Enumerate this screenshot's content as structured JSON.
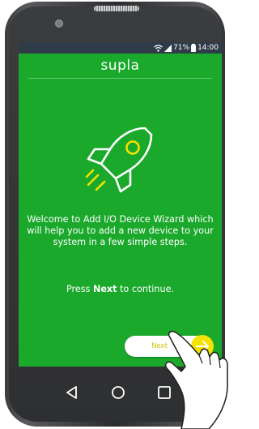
{
  "status_bar": {
    "battery": "71%",
    "time": "14:00",
    "icons": [
      "wifi-icon",
      "signal-icon",
      "battery-icon"
    ]
  },
  "app": {
    "title": "supla"
  },
  "wizard": {
    "welcome_text": "Welcome to Add I/O Device Wizard which will help you to add a new device to your system in a few simple steps.",
    "continue_prefix": "Press",
    "continue_bold": "Next",
    "continue_suffix": "to continue.",
    "next_button_label": "Next",
    "hero_icon": "rocket-icon"
  },
  "navigation": {
    "items": [
      "back-icon",
      "home-icon",
      "recents-icon"
    ]
  },
  "colors": {
    "background": "#1aa92b",
    "status_bar": "#2f3b49",
    "accent": "#f4e200",
    "button_label": "#c7c800",
    "rocket_stroke": "#ffffff",
    "rocket_window": "#f4e200"
  }
}
